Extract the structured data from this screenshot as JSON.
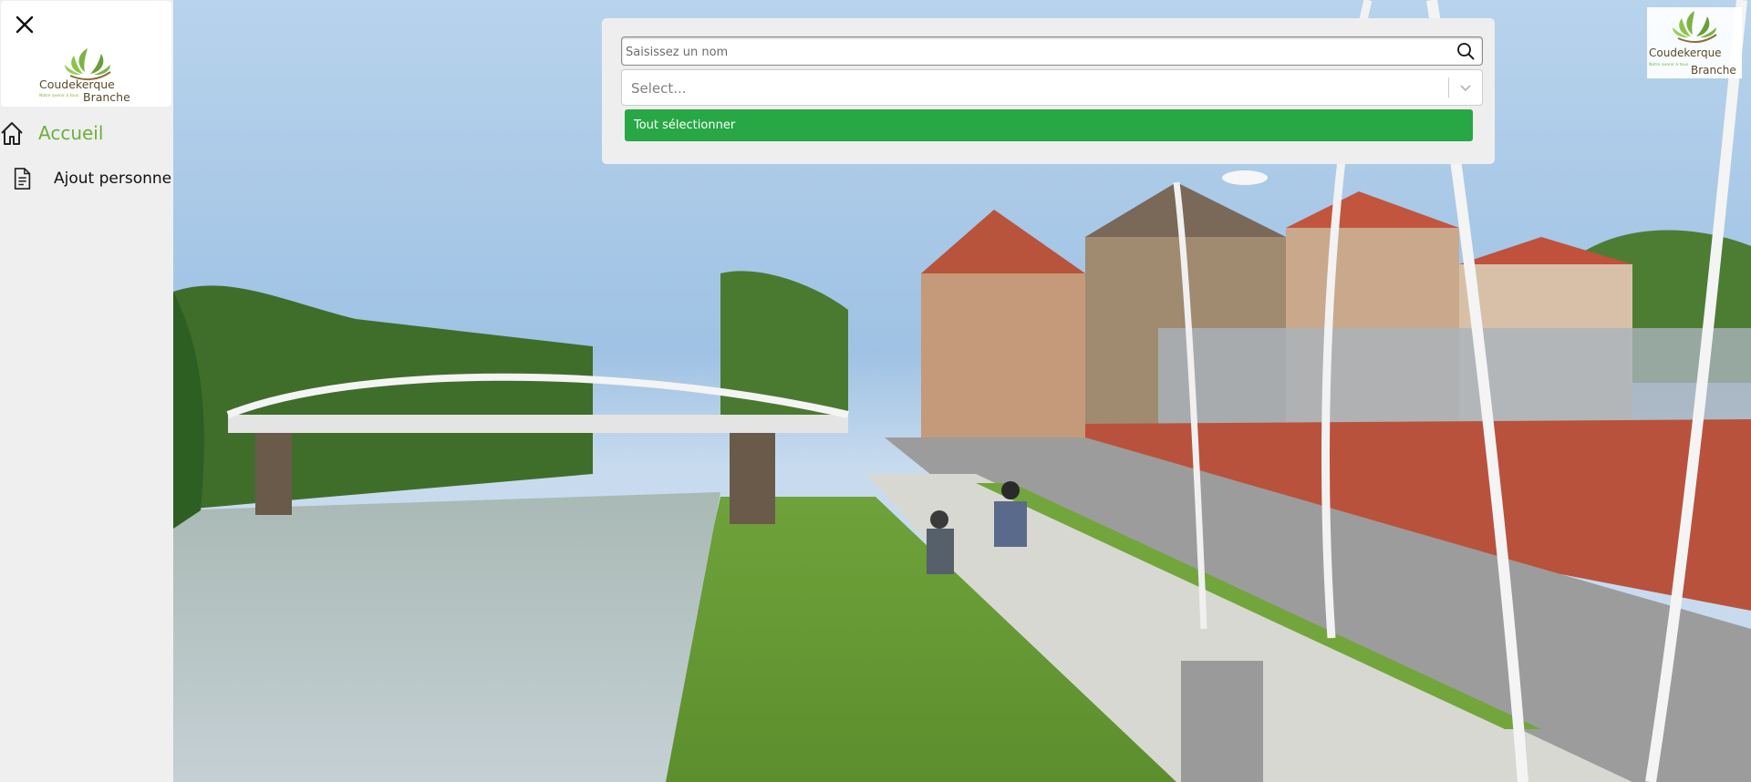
{
  "sidebar": {
    "logo": {
      "line1": "Coudekerque",
      "line2": "Branche",
      "tagline": "Notre avenir à tous"
    },
    "items": [
      {
        "label": "Accueil",
        "icon": "home-icon",
        "active": true
      },
      {
        "label": "Ajout personne",
        "icon": "document-icon",
        "active": false
      }
    ],
    "close_icon": "close-icon"
  },
  "filters": {
    "search": {
      "placeholder": "Saisissez un nom",
      "value": "",
      "icon": "search-icon"
    },
    "select": {
      "placeholder": "Select...",
      "icon": "chevron-down-icon"
    },
    "select_all_label": "Tout sélectionner"
  },
  "corner_logo": {
    "line1": "Coudekerque",
    "line2": "Branche",
    "tagline": "Notre avenir à tous"
  },
  "colors": {
    "accent_green": "#6dae3c",
    "button_green": "#28a745",
    "sidebar_bg": "#efefef"
  }
}
